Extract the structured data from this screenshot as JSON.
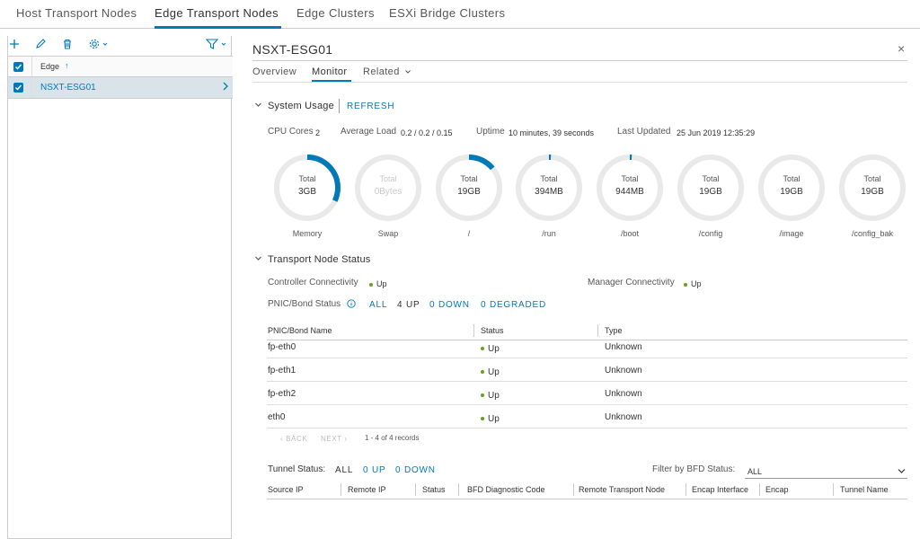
{
  "top_tabs": [
    "Host Transport Nodes",
    "Edge Transport Nodes",
    "Edge Clusters",
    "ESXi Bridge Clusters"
  ],
  "left": {
    "column_header": "Edge",
    "sort_indicator": "↑",
    "rows": [
      {
        "name": "NSXT-ESG01"
      }
    ]
  },
  "detail": {
    "title": "NSXT-ESG01",
    "close": "×",
    "sub_tabs": [
      "Overview",
      "Monitor",
      "Related"
    ],
    "system_usage": {
      "title": "System Usage",
      "refresh": "REFRESH",
      "cpu_cores_label": "CPU Cores",
      "cpu_cores_value": "2",
      "avg_load_label": "Average Load",
      "avg_load_value": "0.2 / 0.2 / 0.15",
      "uptime_label": "Uptime",
      "uptime_value": "10 minutes, 39 seconds",
      "last_updated_label": "Last Updated",
      "last_updated_value": "25 Jun 2019 12:35:29",
      "donuts": [
        {
          "total_label": "Total",
          "value": "3GB",
          "label": "Memory",
          "fraction": 0.32
        },
        {
          "total_label": "Total",
          "value": "0Bytes",
          "label": "Swap",
          "fraction": 0
        },
        {
          "total_label": "Total",
          "value": "19GB",
          "label": "/",
          "fraction": 0.14
        },
        {
          "total_label": "Total",
          "value": "394MB",
          "label": "/run",
          "fraction": 0.01
        },
        {
          "total_label": "Total",
          "value": "944MB",
          "label": "/boot",
          "fraction": 0.01
        },
        {
          "total_label": "Total",
          "value": "19GB",
          "label": "/config",
          "fraction": 0
        },
        {
          "total_label": "Total",
          "value": "19GB",
          "label": "/image",
          "fraction": 0
        },
        {
          "total_label": "Total",
          "value": "19GB",
          "label": "/config_bak",
          "fraction": 0
        }
      ]
    },
    "transport_status": {
      "title": "Transport Node Status",
      "controller_label": "Controller Connectivity",
      "controller_value": "Up",
      "manager_label": "Manager Connectivity",
      "manager_value": "Up",
      "pnic_label": "PNIC/Bond Status",
      "filter_all": "ALL",
      "filter_up": "4 UP",
      "filter_down": "0 DOWN",
      "filter_degraded": "0 DEGRADED",
      "columns": [
        "PNIC/Bond Name",
        "Status",
        "Type"
      ],
      "rows": [
        {
          "name": "fp-eth0",
          "status": "Up",
          "type": "Unknown"
        },
        {
          "name": "fp-eth1",
          "status": "Up",
          "type": "Unknown"
        },
        {
          "name": "fp-eth2",
          "status": "Up",
          "type": "Unknown"
        },
        {
          "name": "eth0",
          "status": "Up",
          "type": "Unknown"
        }
      ],
      "pager_back": "‹ BACK",
      "pager_next": "NEXT ›",
      "pager_info": "1 - 4 of 4 records"
    },
    "tunnel": {
      "label": "Tunnel Status:",
      "filter_all": "ALL",
      "filter_up": "0 UP",
      "filter_down": "0 DOWN",
      "bfd_filter_label": "Filter by BFD Status:",
      "bfd_filter_value": "ALL",
      "columns": [
        "Source IP",
        "Remote IP",
        "Status",
        "BFD Diagnostic Code",
        "Remote Transport Node",
        "Encap Interface",
        "Encap",
        "Tunnel Name"
      ]
    }
  },
  "colors": {
    "accent": "#0079b8",
    "ring": "#e9e9e9",
    "up": "#62a420",
    "selected_row": "#d9e4ea"
  }
}
